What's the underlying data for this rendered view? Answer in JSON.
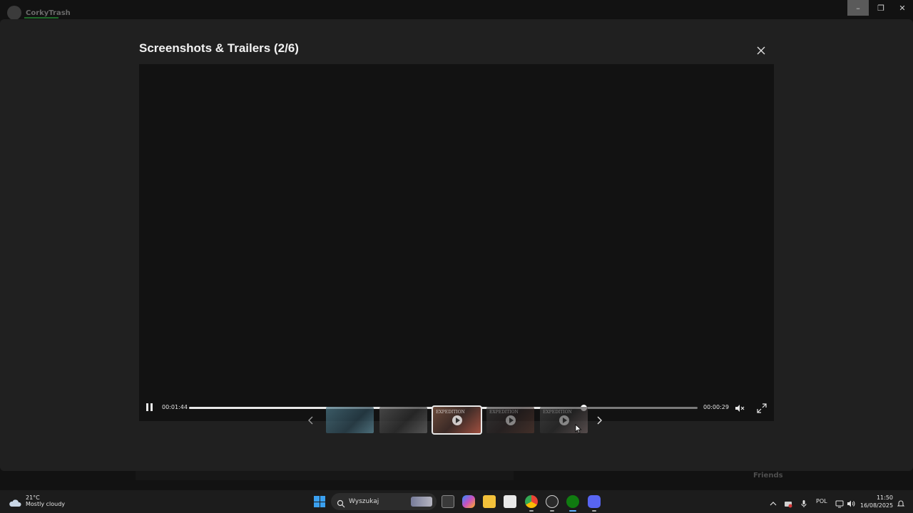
{
  "window": {
    "title": "Screenshots & Trailers (2/6)",
    "minimize": "–",
    "maximize": "❐",
    "close": "✕"
  },
  "background": {
    "user": "CorkyTrash",
    "friends_label": "Friends"
  },
  "player": {
    "elapsed": "00:01:44",
    "remaining": "00:00:29",
    "progress_fraction": 0.776,
    "state": "playing"
  },
  "thumbnails": [
    {
      "kind": "screenshot",
      "selected": false,
      "text": ""
    },
    {
      "kind": "screenshot",
      "selected": false,
      "text": ""
    },
    {
      "kind": "trailer",
      "selected": true,
      "text": "EXPEDITION"
    },
    {
      "kind": "trailer",
      "selected": false,
      "text": "EXPEDITION"
    },
    {
      "kind": "trailer",
      "selected": false,
      "text": "EXPEDITION"
    }
  ],
  "taskbar": {
    "weather_temp": "21°C",
    "weather_desc": "Mostly cloudy",
    "search_placeholder": "Wyszukaj",
    "language": "POL",
    "time": "11:50",
    "date": "16/08/2025",
    "apps": [
      "file-explorer",
      "copilot",
      "folder",
      "store",
      "chrome",
      "steam",
      "xbox",
      "discord"
    ],
    "active_app": "xbox",
    "accent_color": "#3aa0f0"
  }
}
